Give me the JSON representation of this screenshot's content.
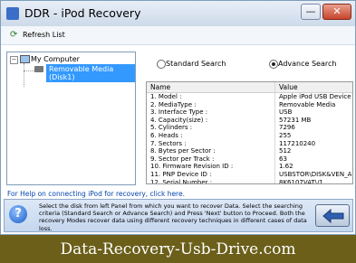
{
  "window": {
    "title": "DDR - iPod Recovery",
    "minimize_glyph": "—",
    "close_glyph": "✕"
  },
  "toolbar": {
    "refresh_label": "Refresh List",
    "refresh_icon": "refresh-icon"
  },
  "tree": {
    "expander": "−",
    "root": "My Computer",
    "selected_item": "Removable Media (Disk1)"
  },
  "search": {
    "standard_label": "Standard Search",
    "advanced_label": "Advance Search",
    "selected": "advanced"
  },
  "table": {
    "headers": [
      "Name",
      "Value"
    ],
    "rows": [
      [
        "1. Model :",
        "Apple iPod USB Device"
      ],
      [
        "2. MediaType :",
        "Removable Media"
      ],
      [
        "3. Interface Type :",
        "USB"
      ],
      [
        "4. Capacity(size) :",
        "57231 MB"
      ],
      [
        "5. Cylinders :",
        "7296"
      ],
      [
        "6. Heads :",
        "255"
      ],
      [
        "7. Sectors :",
        "117210240"
      ],
      [
        "8. Bytes per Sector :",
        "512"
      ],
      [
        "9. Sector per Track :",
        "63"
      ],
      [
        "10. Firmware Revision ID :",
        "1.62"
      ],
      [
        "11. PNP Device ID :",
        "USBSTOR\\DISK&VEN_APPL"
      ],
      [
        "12. Serial Number :",
        "8K6107VAT\\/1"
      ]
    ]
  },
  "help_link": "For Help on connecting iPod for recovery, click here.",
  "info": {
    "icon": "?",
    "text": "Select the disk from left Panel from which you want to recover Data. Select the searching criteria (Standard Search or Advance Search) and Press 'Next' button to Proceed. Both the recovery Modes recover data using different recovery techniques in different cases of data loss."
  },
  "banner": "Data-Recovery-Usb-Drive.com"
}
